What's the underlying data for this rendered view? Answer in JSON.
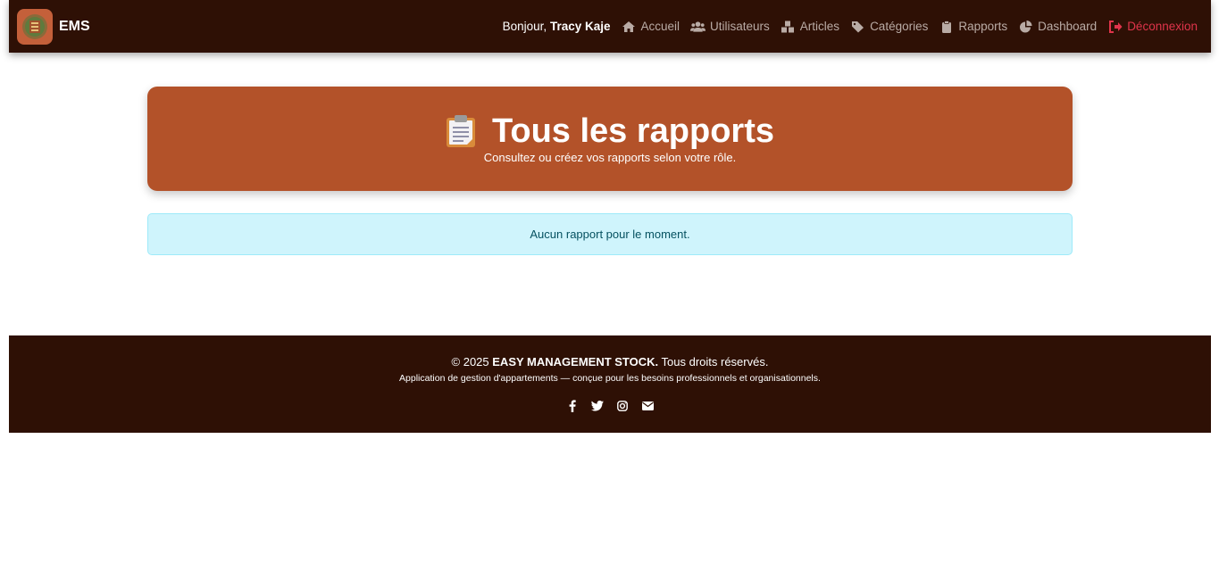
{
  "navbar": {
    "brand": "EMS",
    "greeting_prefix": "Bonjour, ",
    "user_name": "Tracy Kaje",
    "links": [
      {
        "label": "Accueil",
        "icon": "home-icon"
      },
      {
        "label": "Utilisateurs",
        "icon": "users-icon"
      },
      {
        "label": "Articles",
        "icon": "boxes-icon"
      },
      {
        "label": "Catégories",
        "icon": "tags-icon"
      },
      {
        "label": "Rapports",
        "icon": "clipboard-icon"
      },
      {
        "label": "Dashboard",
        "icon": "chart-pie-icon"
      },
      {
        "label": "Déconnexion",
        "icon": "sign-out-icon"
      }
    ]
  },
  "hero": {
    "title": "Tous les rapports",
    "subtitle": "Consultez ou créez vos rapports selon votre rôle."
  },
  "alert": {
    "message": "Aucun rapport pour le moment."
  },
  "footer": {
    "copy_prefix": "© 2025 ",
    "company": "EASY MANAGEMENT STOCK.",
    "copy_suffix": " Tous droits réservés.",
    "description": "Application de gestion d'appartements — conçue pour les besoins professionnels et organisationnels.",
    "social": [
      "facebook-icon",
      "twitter-icon",
      "instagram-icon",
      "envelope-icon"
    ]
  },
  "colors": {
    "navbar_bg": "#2e1005",
    "hero_bg": "#b35229",
    "alert_bg": "#cff4fc",
    "logout": "#e0344b"
  }
}
